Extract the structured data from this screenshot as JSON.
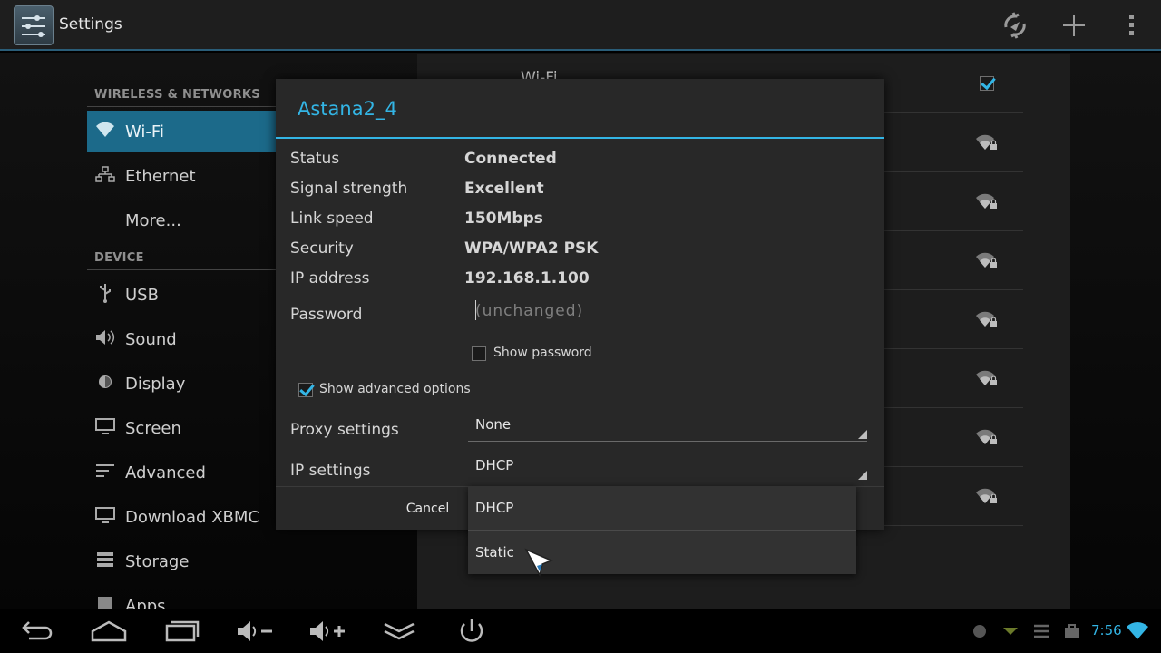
{
  "action_bar": {
    "title": "Settings",
    "icons": [
      "settings-app-icon",
      "wifi-sync-icon",
      "add-icon",
      "overflow-menu-icon"
    ],
    "add_glyph": "+",
    "overflow_glyph": "⋮"
  },
  "sidebar": {
    "sections": [
      {
        "header": "WIRELESS & NETWORKS",
        "items": [
          {
            "label": "Wi-Fi",
            "icon": "wifi-icon",
            "selected": true
          },
          {
            "label": "Ethernet",
            "icon": "ethernet-icon"
          },
          {
            "label": "More...",
            "icon": ""
          }
        ]
      },
      {
        "header": "DEVICE",
        "items": [
          {
            "label": "USB",
            "icon": "usb-icon"
          },
          {
            "label": "Sound",
            "icon": "speaker-icon"
          },
          {
            "label": "Display",
            "icon": "brightness-icon"
          },
          {
            "label": "Screen",
            "icon": "monitor-icon"
          },
          {
            "label": "Advanced",
            "icon": "lines-icon"
          },
          {
            "label": "Download XBMC",
            "icon": "monitor-icon"
          },
          {
            "label": "Storage",
            "icon": "storage-icon"
          },
          {
            "label": "Apps",
            "icon": "apps-icon"
          }
        ]
      }
    ]
  },
  "wifi_panel": {
    "toggle_label": "Wi-Fi",
    "toggle_checked": true,
    "network_count": 7
  },
  "dialog": {
    "title": "Astana2_4",
    "info": [
      {
        "label": "Status",
        "value": "Connected"
      },
      {
        "label": "Signal strength",
        "value": "Excellent"
      },
      {
        "label": "Link speed",
        "value": "150Mbps"
      },
      {
        "label": "Security",
        "value": "WPA/WPA2 PSK"
      },
      {
        "label": "IP address",
        "value": "192.168.1.100"
      }
    ],
    "password_label": "Password",
    "password_placeholder": "(unchanged)",
    "show_password_label": "Show password",
    "show_password_checked": false,
    "advanced_label": "Show advanced options",
    "advanced_checked": true,
    "proxy_label": "Proxy settings",
    "proxy_value": "None",
    "ip_label": "IP settings",
    "ip_value": "DHCP",
    "cancel_label": "Cancel"
  },
  "ip_dropdown": {
    "options": [
      "DHCP",
      "Static"
    ]
  },
  "system_bar": {
    "clock": "7:56",
    "accent": "#33b5e5",
    "buttons": [
      "back-icon",
      "home-icon",
      "recent-apps-icon",
      "volume-down-icon",
      "volume-up-icon",
      "hide-bar-icon",
      "power-icon"
    ]
  },
  "colors": {
    "accent": "#33b5e5",
    "selected": "#1c6a8a"
  }
}
